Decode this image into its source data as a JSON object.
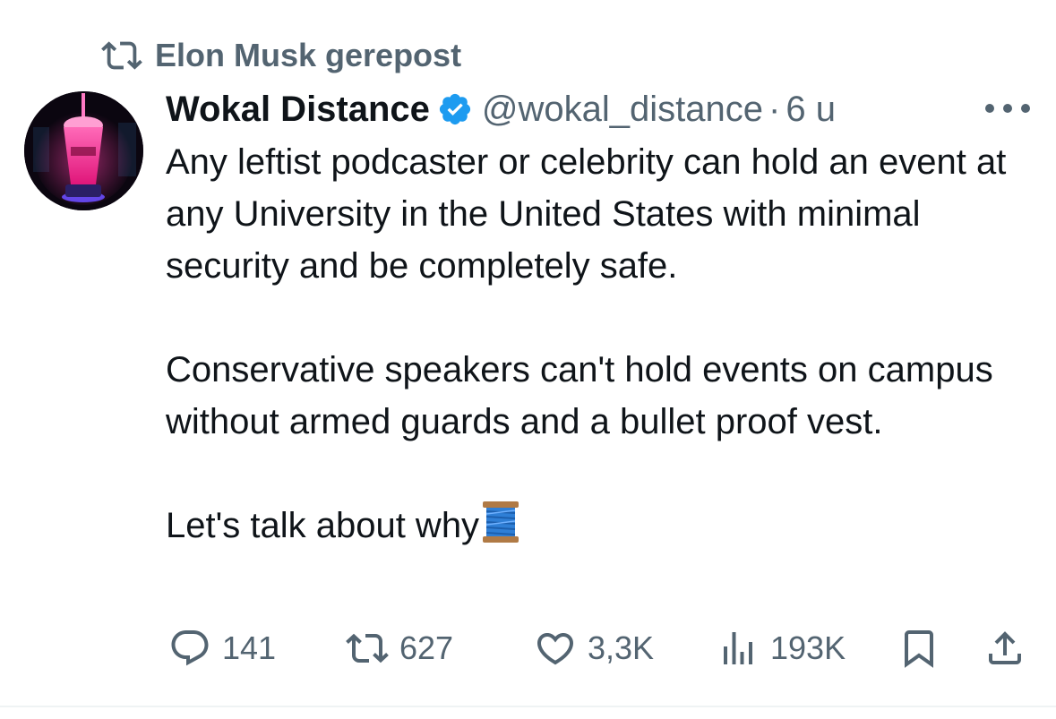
{
  "repost": {
    "label": "Elon Musk gerepost",
    "icon": "repost-icon"
  },
  "tweet": {
    "author": {
      "display_name": "Wokal Distance",
      "handle": "@wokal_distance",
      "verified": true,
      "verified_color": "#1d9bf0"
    },
    "separator": "·",
    "time": "6 u",
    "paragraphs": [
      "Any leftist podcaster or celebrity can hold an event at any University in the United States with minimal security and be completely safe.",
      "Conservative speakers can't hold events on campus without armed guards and a bullet proof vest.",
      "Let's talk about why"
    ],
    "emoji": "thread-spool-emoji",
    "stats": {
      "replies": "141",
      "reposts": "627",
      "likes": "3,3K",
      "views": "193K"
    }
  },
  "colors": {
    "text_primary": "#0f1419",
    "text_secondary": "#536471",
    "accent": "#1d9bf0"
  }
}
